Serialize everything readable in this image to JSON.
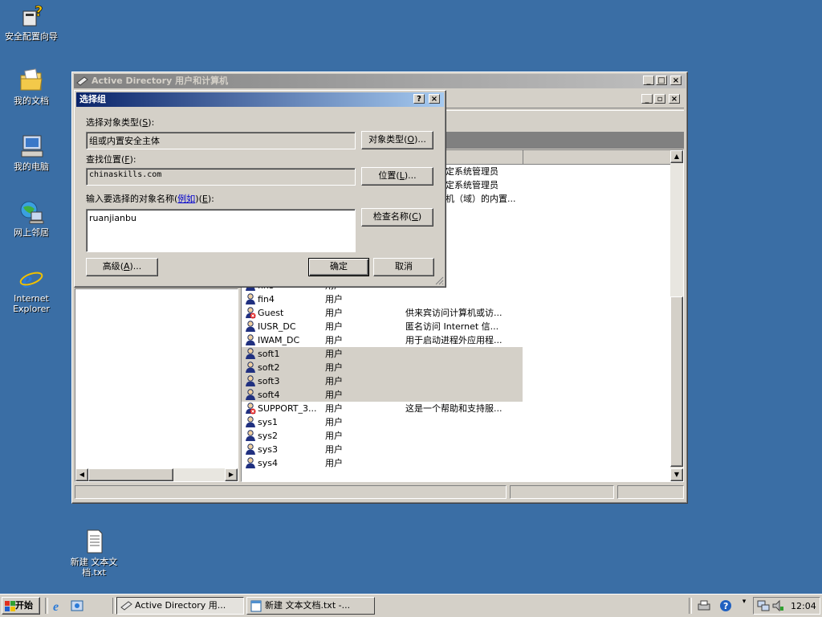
{
  "desktop": {
    "icons": [
      {
        "label": "安全配置向导"
      },
      {
        "label": "我的文档"
      },
      {
        "label": "我的电脑"
      },
      {
        "label": "网上邻居"
      },
      {
        "label": "Internet Explorer"
      },
      {
        "label": "新建 文本文档.txt"
      }
    ]
  },
  "ad_window": {
    "title": "Active Directory 用户和计算机",
    "users": [
      {
        "name": "fin3",
        "type": "用户",
        "desc": ""
      },
      {
        "name": "fin4",
        "type": "用户",
        "desc": ""
      },
      {
        "name": "Guest",
        "type": "用户",
        "desc": "供来宾访问计算机或访...",
        "disabled": true
      },
      {
        "name": "IUSR_DC",
        "type": "用户",
        "desc": "匿名访问 Internet 信..."
      },
      {
        "name": "IWAM_DC",
        "type": "用户",
        "desc": "用于启动进程外应用程..."
      },
      {
        "name": "soft1",
        "type": "用户",
        "desc": "",
        "selected": true
      },
      {
        "name": "soft2",
        "type": "用户",
        "desc": "",
        "selected": true
      },
      {
        "name": "soft3",
        "type": "用户",
        "desc": "",
        "selected": true
      },
      {
        "name": "soft4",
        "type": "用户",
        "desc": "",
        "selected": true
      },
      {
        "name": "SUPPORT_3...",
        "type": "用户",
        "desc": "这是一个帮助和支持服...",
        "disabled": true
      },
      {
        "name": "sys1",
        "type": "用户",
        "desc": ""
      },
      {
        "name": "sys2",
        "type": "用户",
        "desc": ""
      },
      {
        "name": "sys3",
        "type": "用户",
        "desc": ""
      },
      {
        "name": "sys4",
        "type": "用户",
        "desc": ""
      }
    ],
    "partial_desc": [
      "定系统管理员",
      "定系统管理员",
      "机（域）的内置..."
    ]
  },
  "dialog": {
    "title": "选择组",
    "help_btn": "?",
    "close_btn": "×",
    "object_type_label": "选择对象类型",
    "object_type_key": "S",
    "object_type_value": "组或内置安全主体",
    "object_type_btn": "对象类型",
    "object_type_btn_key": "O",
    "location_label": "查找位置",
    "location_key": "F",
    "location_value": "chinaskills.com",
    "location_btn": "位置",
    "location_btn_key": "L",
    "names_label": "输入要选择的对象名称",
    "names_example": "例如",
    "names_key": "E",
    "names_value": "ruanjianbu",
    "check_btn": "检查名称",
    "check_btn_key": "C",
    "advanced_btn": "高级",
    "advanced_btn_key": "A",
    "ok_btn": "确定",
    "cancel_btn": "取消"
  },
  "taskbar": {
    "start": "开始",
    "tasks": [
      {
        "label": "Active Directory 用..."
      },
      {
        "label": "新建 文本文档.txt -..."
      }
    ],
    "clock": "12:04"
  }
}
